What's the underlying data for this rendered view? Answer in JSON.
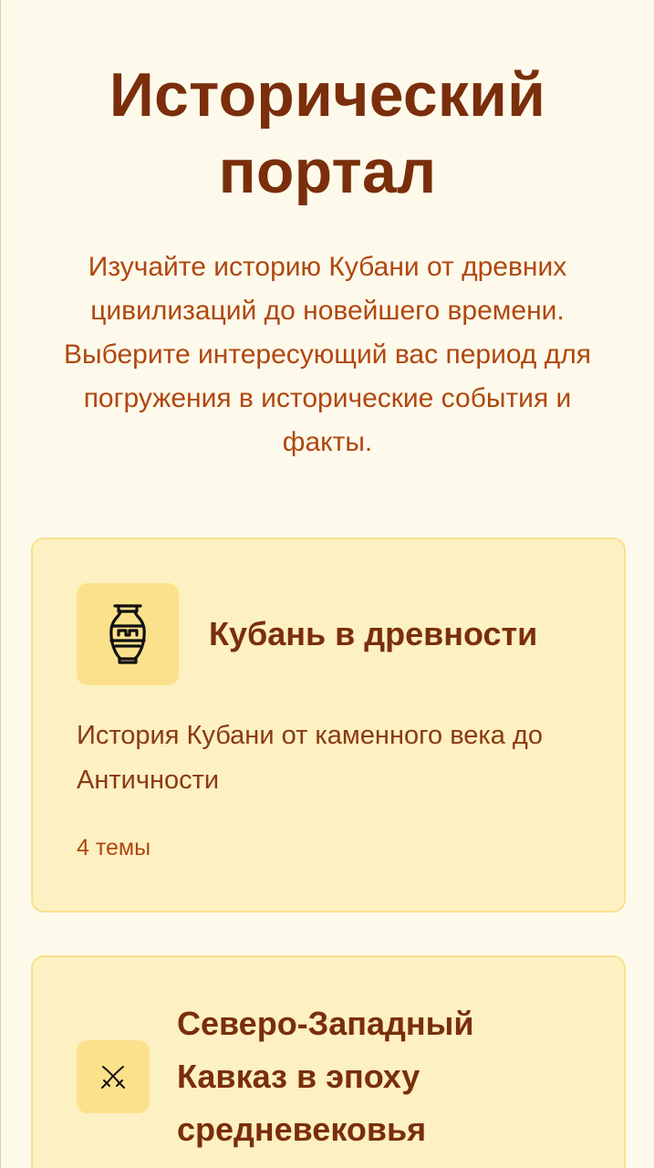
{
  "hero": {
    "title": "Исторический портал",
    "subtitle": "Изучайте историю Кубани от древних цивилизаций до новейшего времени. Выберите интересующий вас период для погружения в исторические события и факты."
  },
  "periods": [
    {
      "icon": "amphora-icon",
      "title": "Кубань в древности",
      "description": "История Кубани от каменного века до Античности",
      "topics": "4 темы"
    },
    {
      "icon": "crossed-sabers-icon",
      "title": "Северо-Западный Кавказ в эпоху средневековья"
    }
  ],
  "colors": {
    "background": "#fefaeb",
    "card": "#fdf0c2",
    "card_border": "#f9e08f",
    "icon_box": "#fce18c",
    "title": "#7a2e0b",
    "accent": "#b0470f"
  }
}
